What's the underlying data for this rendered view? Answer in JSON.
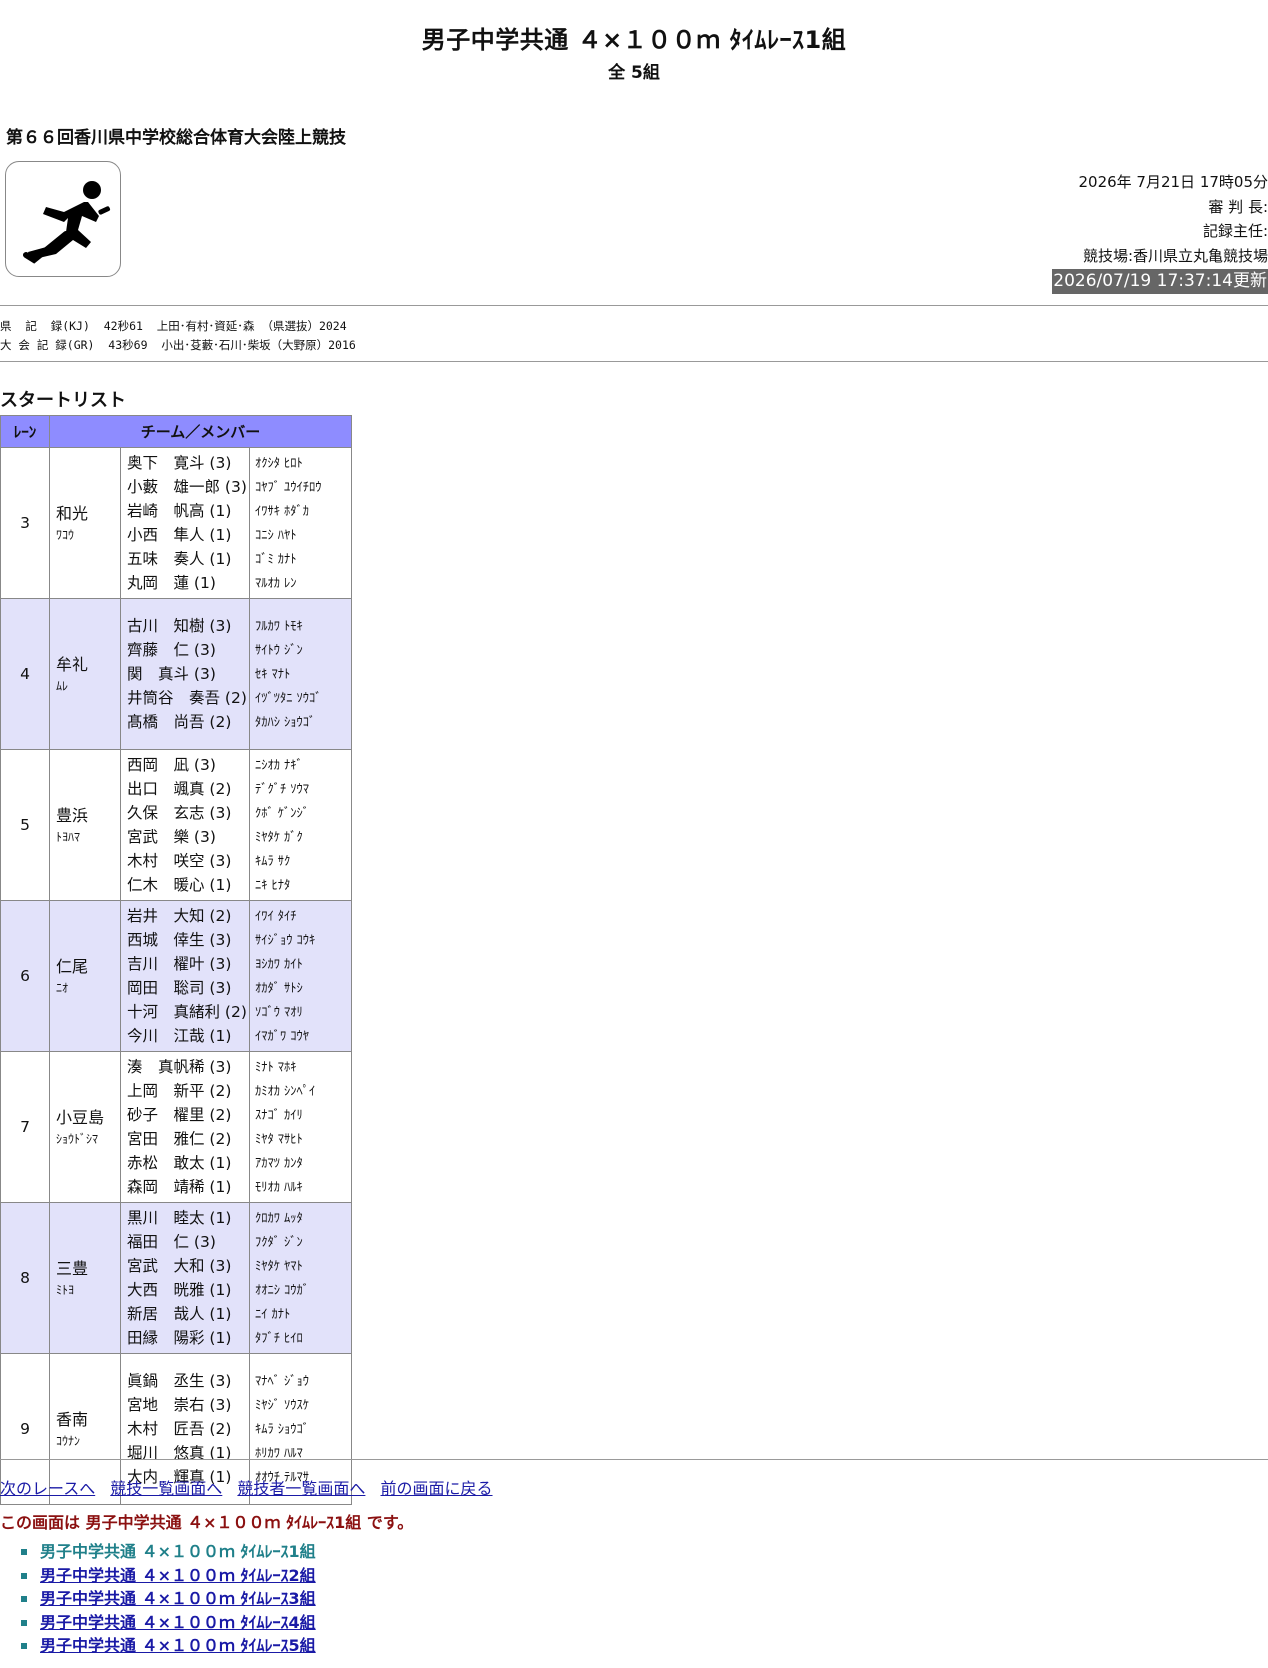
{
  "header": {
    "title": "男子中学共通 ４×１００ｍ ﾀｲﾑﾚｰｽ1組",
    "subtitle": "全 5組"
  },
  "meet": {
    "name": "第６６回香川県中学校総合体育大会陸上競技"
  },
  "logo": {
    "icon": "sprinter-icon"
  },
  "info": {
    "datetime": "2026年 7月21日 17時05分",
    "referee": "審 判 長:",
    "recorder": "記録主任:",
    "venue": "競技場:香川県立丸亀競技場",
    "updated": "2026/07/19 17:37:14更新"
  },
  "records": {
    "kj": "県  記  録(KJ)  42秒61  上田･有村･資延･森 （県選抜）2024",
    "gr": "大 会 記 録(GR)  43秒69  小出･芟藪･石川･柴坂（大野原）2016"
  },
  "startlist": {
    "title": "スタートリスト",
    "lane_header": "ﾚｰﾝ",
    "team_header": "チーム／メンバー",
    "rows": [
      {
        "lane": "3",
        "team": "和光",
        "kana": "ﾜｺｳ",
        "members": [
          "奥下　寛斗 (3)",
          "小藪　雄一郎 (3)",
          "岩崎　帆高 (1)",
          "小西　隼人 (1)",
          "五味　奏人 (1)",
          "丸岡　蓮 (1)"
        ],
        "member_kana": [
          "ｵｸｼﾀ ﾋﾛﾄ",
          "ｺﾔﾌﾞ ﾕｳｲﾁﾛｳ",
          "ｲﾜｻｷ ﾎﾀﾞｶ",
          "ｺﾆｼ ﾊﾔﾄ",
          "ｺﾞﾐ ｶﾅﾄ",
          "ﾏﾙｵｶ ﾚﾝ"
        ]
      },
      {
        "lane": "4",
        "team": "牟礼",
        "kana": "ﾑﾚ",
        "members": [
          "古川　知樹 (3)",
          "齊藤　仁 (3)",
          "関　真斗 (3)",
          "井筒谷　奏吾 (2)",
          "髙橋　尚吾 (2)"
        ],
        "member_kana": [
          "ﾌﾙｶﾜ ﾄﾓｷ",
          "ｻｲﾄｳ ｼﾞﾝ",
          "ｾｷ ﾏﾅﾄ",
          "ｲﾂﾞﾂﾀﾆ ｿｳｺﾞ",
          "ﾀｶﾊｼ ｼｮｳｺﾞ"
        ]
      },
      {
        "lane": "5",
        "team": "豊浜",
        "kana": "ﾄﾖﾊﾏ",
        "members": [
          "西岡　凪 (3)",
          "出口　颯真 (2)",
          "久保　玄志 (3)",
          "宮武　樂 (3)",
          "木村　咲空 (3)",
          "仁木　暖心 (1)"
        ],
        "member_kana": [
          "ﾆｼｵｶ ﾅｷﾞ",
          "ﾃﾞｸﾞﾁ ｿｳﾏ",
          "ｸﾎﾞ ｹﾞﾝｼﾞ",
          "ﾐﾔﾀｹ ｶﾞｸ",
          "ｷﾑﾗ ｻｸ",
          "ﾆｷ ﾋﾅﾀ"
        ]
      },
      {
        "lane": "6",
        "team": "仁尾",
        "kana": "ﾆｵ",
        "members": [
          "岩井　大知 (2)",
          "西城　倖生 (3)",
          "吉川　櫂叶 (3)",
          "岡田　聡司 (3)",
          "十河　真緒利 (2)",
          "今川　江哉 (1)"
        ],
        "member_kana": [
          "ｲﾜｲ ﾀｲﾁ",
          "ｻｲｼﾞｮｳ ｺｳｷ",
          "ﾖｼｶﾜ ｶｲﾄ",
          "ｵｶﾀﾞ ｻﾄｼ",
          "ｿｺﾞｳ ﾏｵﾘ",
          "ｲﾏｶﾞﾜ ｺｳﾔ"
        ]
      },
      {
        "lane": "7",
        "team": "小豆島",
        "kana": "ｼｮｳﾄﾞｼﾏ",
        "members": [
          "湊　真帆稀 (3)",
          "上岡　新平 (2)",
          "砂子　櫂里 (2)",
          "宮田　雅仁 (2)",
          "赤松　敢太 (1)",
          "森岡　靖稀 (1)"
        ],
        "member_kana": [
          "ﾐﾅﾄ ﾏﾎｷ",
          "ｶﾐｵｶ ｼﾝﾍﾟｲ",
          "ｽﾅｺﾞ ｶｲﾘ",
          "ﾐﾔﾀ ﾏｻﾋﾄ",
          "ｱｶﾏﾂ ｶﾝﾀ",
          "ﾓﾘｵｶ ﾊﾙｷ"
        ]
      },
      {
        "lane": "8",
        "team": "三豊",
        "kana": "ﾐﾄﾖ",
        "members": [
          "黒川　睦太 (1)",
          "福田　仁 (3)",
          "宮武　大和 (3)",
          "大西　晄雅 (1)",
          "新居　哉人 (1)",
          "田縁　陽彩 (1)"
        ],
        "member_kana": [
          "ｸﾛｶﾜ ﾑｯﾀ",
          "ﾌｸﾀﾞ ｼﾞﾝ",
          "ﾐﾔﾀｹ ﾔﾏﾄ",
          "ｵｵﾆｼ ｺｳｶﾞ",
          "ﾆｲ ｶﾅﾄ",
          "ﾀﾌﾞﾁ ﾋｲﾛ"
        ]
      },
      {
        "lane": "9",
        "team": "香南",
        "kana": "ｺｳﾅﾝ",
        "members": [
          "眞鍋　丞生 (3)",
          "宮地　崇右 (3)",
          "木村　匠吾 (2)",
          "堀川　悠真 (1)",
          "大内　輝真 (1)"
        ],
        "member_kana": [
          "ﾏﾅﾍﾞ ｼﾞｮｳ",
          "ﾐﾔｼﾞ ｿｳｽｹ",
          "ｷﾑﾗ ｼｮｳｺﾞ",
          "ﾎﾘｶﾜ ﾊﾙﾏ",
          "ｵｵｳﾁ ﾃﾙﾏｻ"
        ]
      }
    ]
  },
  "nav": {
    "next": "次のレースへ",
    "event_list": "競技一覧画面へ",
    "athlete_list": "競技者一覧画面へ",
    "back": "前の画面に戻る"
  },
  "this_screen": "この画面は 男子中学共通 ４×１００ｍ ﾀｲﾑﾚｰｽ1組 です。",
  "races": [
    "男子中学共通 ４×１００ｍ ﾀｲﾑﾚｰｽ1組",
    "男子中学共通 ４×１００ｍ ﾀｲﾑﾚｰｽ2組",
    "男子中学共通 ４×１００ｍ ﾀｲﾑﾚｰｽ3組",
    "男子中学共通 ４×１００ｍ ﾀｲﾑﾚｰｽ4組",
    "男子中学共通 ４×１００ｍ ﾀｲﾑﾚｰｽ5組"
  ]
}
